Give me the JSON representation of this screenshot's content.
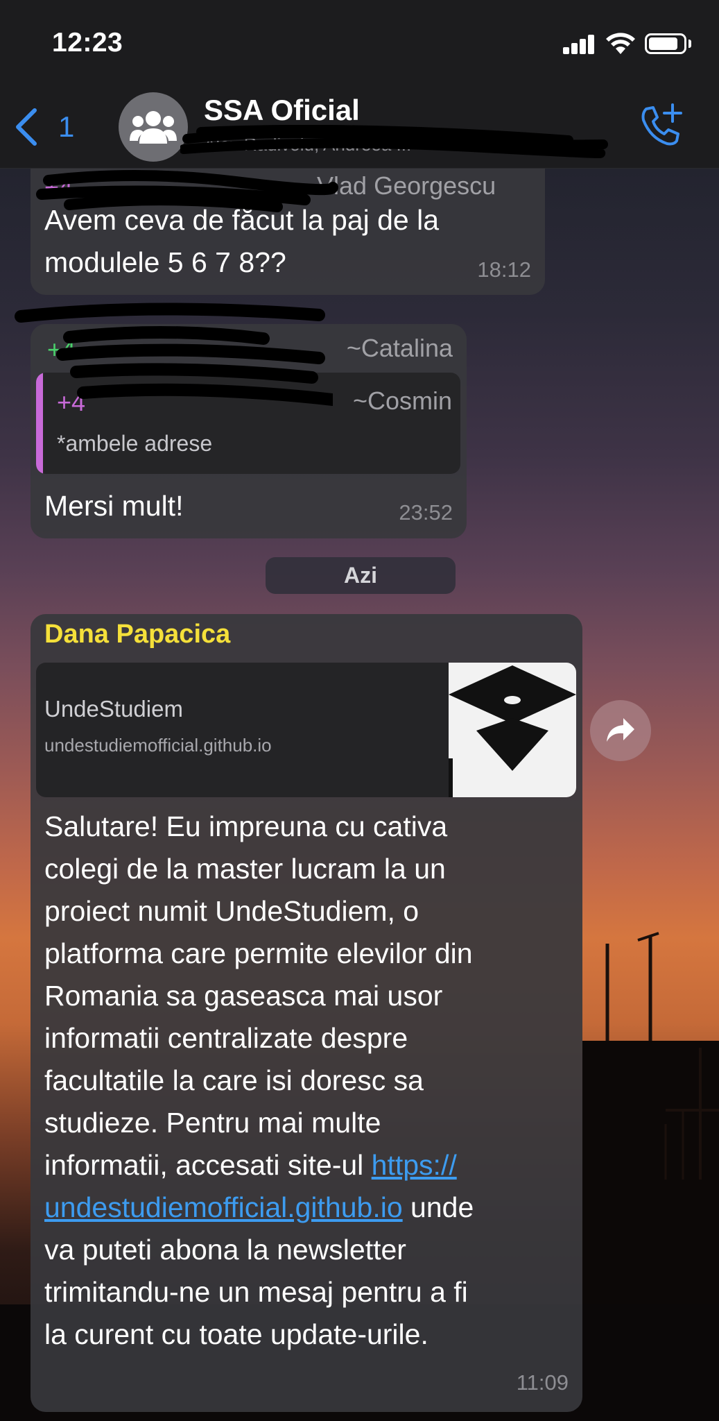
{
  "status_bar": {
    "time": "12:23",
    "battery_level": 0.85
  },
  "header": {
    "back_count": "1",
    "title": "SSA Oficial",
    "subtitle": "Alex Radivoiu, Andreea ...",
    "icons": {
      "back": "chevron-left-icon",
      "avatar": "group-icon",
      "call": "add-call-icon"
    }
  },
  "messages": [
    {
      "sender": "~Vlad Georgescu",
      "sender_phone": "+4",
      "text_line1": "Avem ceva de făcut la paj de la",
      "text_line2": "modulele 5 6 7 8??",
      "time": "18:12"
    },
    {
      "sender": "~Catalina",
      "sender_phone": "+4",
      "quoted_sender": "~Cosmin",
      "quoted_phone": "+4",
      "quoted_text": "*ambele adrese",
      "text": "Mersi mult!",
      "time": "23:52"
    }
  ],
  "date_separator": "Azi",
  "last_message": {
    "sender": "Dana Papacica",
    "sender_color": "#f5e03a",
    "link_preview": {
      "title": "UndeStudiem",
      "url": "undestudiemofficial.github.io",
      "thumb_icon": "graduation-cap-icon"
    },
    "lines": [
      "Salutare! Eu impreuna cu cativa",
      "colegi de la master lucram la un",
      "proiect numit UndeStudiem, o",
      "platforma care permite elevilor din",
      "Romania sa gaseasca mai usor",
      "informatii centralizate despre",
      "facultatile la care isi doresc sa",
      "studieze. Pentru mai multe"
    ],
    "line9_pre": "informatii, accesati site-ul ",
    "link_part1": "https://",
    "link_part2": "undestudiemofficial.github.io",
    "line10_post": " unde",
    "lines_after": [
      "va puteti abona la newsletter",
      "trimitandu-ne un mesaj pentru a fi",
      "la curent cu toate update-urile."
    ],
    "time": "11:09"
  },
  "forward_icon": "forward-icon"
}
